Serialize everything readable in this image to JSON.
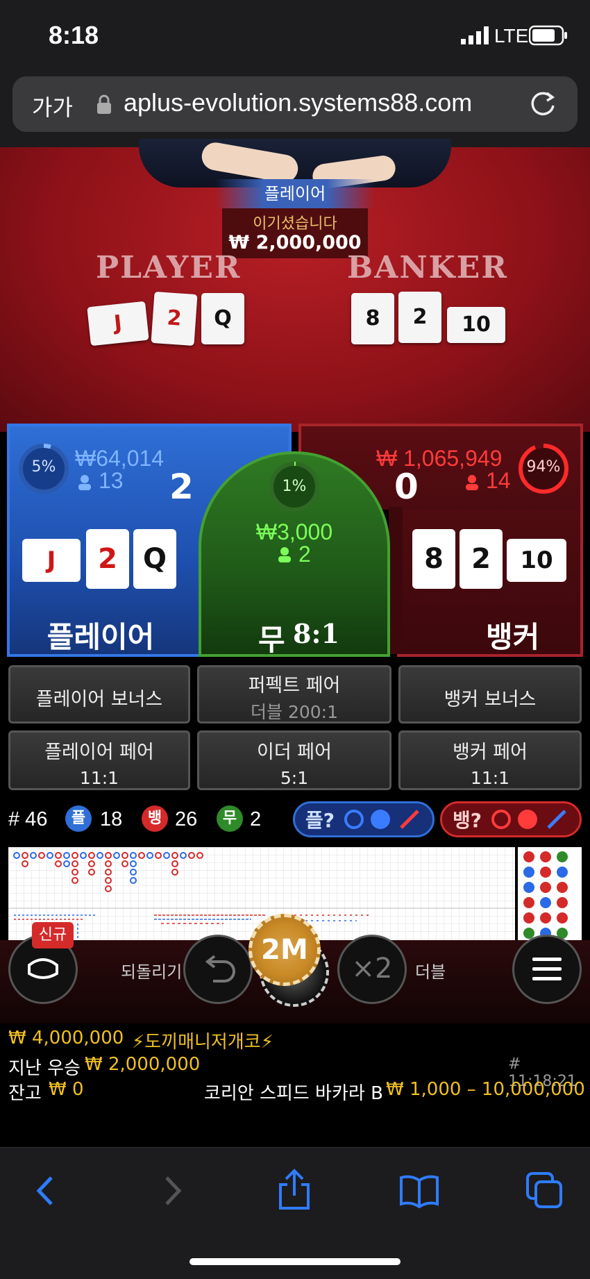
{
  "status_bar": {
    "time": "8:18",
    "network": "LTE"
  },
  "browser": {
    "text_size_button": "가가",
    "url": "aplus-evolution.systems88.com"
  },
  "table": {
    "win_banner": "플레이어",
    "win_text": "이기셨습니다",
    "win_amount": "₩ 2,000,000",
    "player_label": "PLAYER",
    "banker_label": "BANKER",
    "player_cards": [
      "J",
      "2",
      "Q"
    ],
    "banker_cards": [
      "8",
      "2",
      "10"
    ]
  },
  "bets": {
    "player": {
      "percent": "5%",
      "amount": "₩64,014",
      "players": "13",
      "score": "2",
      "name": "플레이어",
      "cards": [
        "J",
        "2",
        "Q"
      ]
    },
    "banker": {
      "percent": "94%",
      "amount": "₩ 1,065,949",
      "players": "14",
      "score": "0",
      "name": "뱅커",
      "cards": [
        "8",
        "2",
        "10"
      ]
    },
    "tie": {
      "percent": "1%",
      "amount": "₩3,000",
      "players": "2",
      "name": "무",
      "payout": "8:1"
    }
  },
  "side_bets": [
    {
      "label": "플레이어 보너스",
      "sub": ""
    },
    {
      "label": "퍼펙트 페어",
      "sub": "더블 200:1"
    },
    {
      "label": "뱅커 보너스",
      "sub": ""
    },
    {
      "label": "플레이어 페어",
      "sub": "11:1"
    },
    {
      "label": "이더 페어",
      "sub": "5:1"
    },
    {
      "label": "뱅커 페어",
      "sub": "11:1"
    }
  ],
  "stats": {
    "round": "# 46",
    "player_badge": "플",
    "player_count": "18",
    "banker_badge": "뱅",
    "banker_count": "26",
    "tie_badge": "무",
    "tie_count": "2",
    "player_predict": "플?",
    "banker_predict": "뱅?"
  },
  "controls": {
    "new_badge": "신규",
    "undo_label": "되돌리기",
    "chip_value": "2M",
    "double_icon": "×2",
    "double_label": "더블"
  },
  "info": {
    "top_winner_amount": "₩ 4,000,000",
    "top_winner_name": "⚡도끼매니저개코⚡",
    "last_win_label": "지난 우승",
    "last_win_amount": "₩ 2,000,000",
    "round_time": "# 11:18:21",
    "balance_label": "잔고",
    "balance_amount": "₩ 0",
    "game_name": "코리안 스피드 바카라 B",
    "bet_limits": "₩ 1,000 – 10,000,000"
  },
  "colors": {
    "player": "#2f6fd6",
    "banker": "#a8242a",
    "tie": "#2f7a23",
    "gold": "#f0c020"
  }
}
